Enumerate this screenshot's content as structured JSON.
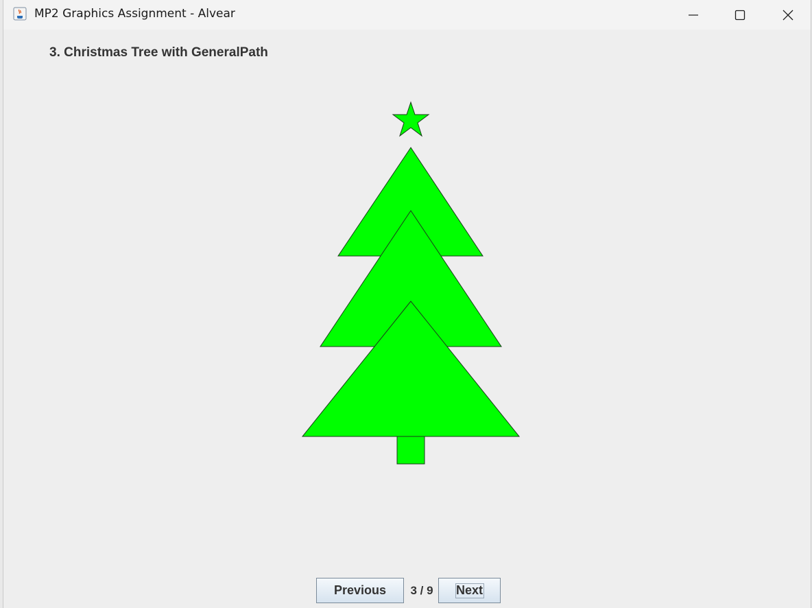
{
  "window": {
    "title": "MP2 Graphics Assignment - Alvear"
  },
  "page": {
    "heading": "3. Christmas Tree with GeneralPath"
  },
  "drawing": {
    "fill_color": "#00ff00",
    "stroke_color": "#1a3a1a",
    "shapes": [
      "star",
      "tree-tier-top",
      "tree-tier-middle",
      "tree-tier-bottom",
      "tree-trunk"
    ]
  },
  "navigation": {
    "previous_label": "Previous",
    "next_label": "Next",
    "counter": "3 / 9"
  }
}
